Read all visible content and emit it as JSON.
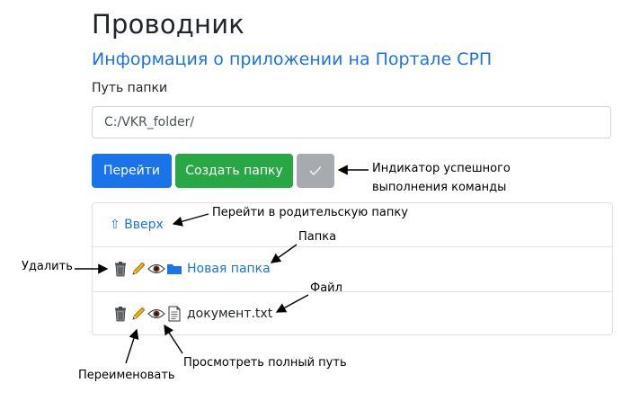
{
  "app": {
    "title": "Проводник",
    "link": "Информация о приложении на Портале СРП"
  },
  "path": {
    "label": "Путь папки",
    "value": "C:/VKR_folder/"
  },
  "buttons": {
    "go": "Перейти",
    "create": "Создать папку",
    "status_icon": "check-icon"
  },
  "list": {
    "up_label": "⇧ Вверх",
    "items": [
      {
        "type": "folder",
        "name": "Новая папка",
        "icons": [
          "trash-icon",
          "pencil-icon",
          "eye-icon",
          "folder-icon"
        ]
      },
      {
        "type": "file",
        "name": "документ.txt",
        "icons": [
          "trash-icon",
          "pencil-icon",
          "eye-icon",
          "file-icon"
        ]
      }
    ]
  },
  "annotations": {
    "indicator_line1": "Индикатор успешного",
    "indicator_line2": "выполнения команды",
    "parent": "Перейти в родительскую папку",
    "folder": "Папка",
    "delete": "Удалить",
    "file": "Файл",
    "rename": "Переименовать",
    "fullpath": "Просмотреть полный путь"
  },
  "colors": {
    "primary": "#1a73e8",
    "success": "#28a745",
    "secondary": "#a7abaf",
    "link": "#1b73e8"
  }
}
